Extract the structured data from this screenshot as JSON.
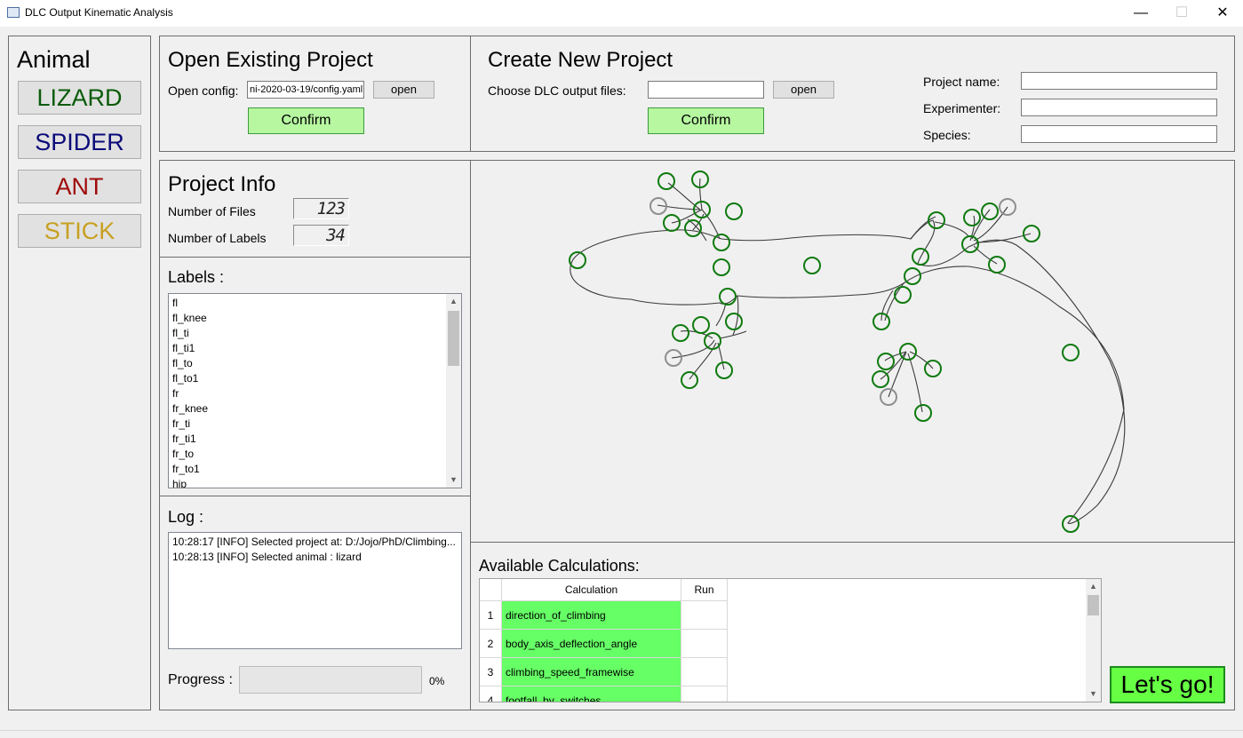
{
  "window": {
    "title": "DLC Output Kinematic Analysis",
    "minimize": "—",
    "maximize": "☐",
    "close": "✕"
  },
  "animal": {
    "heading": "Animal",
    "buttons": [
      {
        "label": "LIZARD",
        "color": "#0a5b0a"
      },
      {
        "label": "SPIDER",
        "color": "#0a0a7a"
      },
      {
        "label": "ANT",
        "color": "#a00a0a"
      },
      {
        "label": "STICK",
        "color": "#c8a020"
      }
    ]
  },
  "open_project": {
    "heading": "Open Existing Project",
    "config_label": "Open config:",
    "config_value": "ni-2020-03-19/config.yaml",
    "open_label": "open",
    "confirm_label": "Confirm"
  },
  "new_project": {
    "heading": "Create New Project",
    "files_label": "Choose DLC output files:",
    "files_value": "",
    "open_label": "open",
    "confirm_label": "Confirm",
    "name_label": "Project name:",
    "experimenter_label": "Experimenter:",
    "species_label": "Species:"
  },
  "project_info": {
    "heading": "Project Info",
    "files_label": "Number of Files",
    "files_value": "123",
    "labels_label": "Number of Labels",
    "labels_value": "34"
  },
  "labels": {
    "heading": "Labels :",
    "items": [
      "fl",
      "fl_knee",
      "fl_ti",
      "fl_ti1",
      "fl_to",
      "fl_to1",
      "fr",
      "fr_knee",
      "fr_ti",
      "fr_ti1",
      "fr_to",
      "fr_to1",
      "hip"
    ]
  },
  "log": {
    "heading": "Log :",
    "lines": [
      "10:28:17 [INFO]  Selected project at: D:/Jojo/PhD/Climbing...",
      "10:28:13 [INFO]  Selected animal : lizard"
    ]
  },
  "progress": {
    "label": "Progress :",
    "value": 0,
    "text": "0%"
  },
  "calculations": {
    "heading": "Available Calculations:",
    "col_calc": "Calculation",
    "col_run": "Run",
    "rows": [
      {
        "num": "1",
        "name": "direction_of_climbing"
      },
      {
        "num": "2",
        "name": "body_axis_deflection_angle"
      },
      {
        "num": "3",
        "name": "climbing_speed_framewise"
      },
      {
        "num": "4",
        "name": "footfall_by_switches"
      }
    ]
  },
  "lets_go": {
    "label": "Let's go!"
  }
}
